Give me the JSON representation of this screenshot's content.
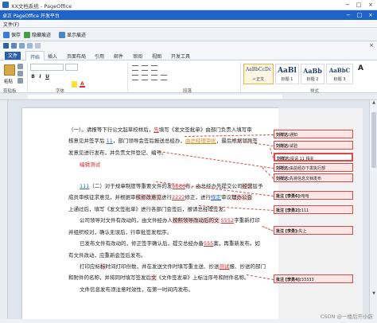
{
  "window": {
    "title": "XX文档系统 - PageOffice",
    "minimize": "−",
    "maximize": "□",
    "close": "×"
  },
  "po": {
    "title": "卓正 PageOffice 开发平台",
    "menu": "文件(F)",
    "toolbar": [
      {
        "label": "保存",
        "color": "#3a7bd5"
      },
      {
        "label": "隐藏痕迹",
        "color": "#4a9a4a"
      },
      {
        "label": "显示痕迹",
        "color": "#4a86c8"
      }
    ]
  },
  "word": {
    "tabs": [
      "文件",
      "开始",
      "插入",
      "页面布局",
      "引用",
      "邮件",
      "审阅",
      "视图",
      "开发工具"
    ],
    "active_tab": "开始",
    "groups": {
      "clipboard": "剪贴板",
      "paste": "粘贴",
      "font": "字体",
      "paragraph": "段落",
      "styles": "样式"
    },
    "format_buttons": [
      "B",
      "I",
      "U"
    ],
    "styles": [
      {
        "sample": "AaBbCcDc",
        "name": "↵正文",
        "active": true
      },
      {
        "sample": "AaBl",
        "name": "标题 1"
      },
      {
        "sample": "AaBb",
        "name": "标题 2"
      },
      {
        "sample": "AaBbC",
        "name": "标题 3"
      }
    ]
  },
  "document": {
    "lines": [
      {
        "parts": [
          {
            "t": "（一）。请报等下行公文起草校样后，"
          },
          {
            "t": "先",
            "c": "ins"
          },
          {
            "t": "填写《发文签批单》由部门负责人填写审"
          }
        ]
      },
      {
        "parts": [
          {
            "t": "核意见并签字后 "
          },
          {
            "t": "11",
            "c": "ins-blue"
          },
          {
            "t": "，部门领导会签后报送总经办，"
          },
          {
            "t": "由总经理审批",
            "c": "ins-orange"
          },
          {
            "t": "，最后根据领导签"
          }
        ]
      },
      {
        "parts": [
          {
            "t": "发意见进行发布，并负责文件登记、编号。"
          }
        ]
      },
      {
        "parts": [
          {
            "t": "编辑测试"
          }
        ],
        "red": true
      },
      {
        "parts": [
          {
            "t": "111",
            "c": "ins-blue"
          },
          {
            "t": "（二）对于规章制度等重要文件的发"
          },
          {
            "t": "6666",
            "c": "ins"
          },
          {
            "t": "布，由总经办先提交公司"
          },
          {
            "t": "经营",
            "c": "hl"
          },
          {
            "t": "层予"
          }
        ]
      },
      {
        "parts": [
          {
            "t": "成员审核征求意见，并根据审"
          },
          {
            "t": "核修改意见",
            "c": "hl"
          },
          {
            "t": "进行"
          },
          {
            "t": "2222",
            "c": "ins"
          },
          {
            "t": "修正，进行"
          },
          {
            "t": "规定",
            "c": "ins-blue"
          },
          {
            "t": "审议"
          },
          {
            "t": "理办公会",
            "c": "hl"
          }
        ]
      },
      {
        "parts": [
          {
            "t": "上通过后，填写《发文签批单》进行各部门会签后，报请总经理签发。"
          }
        ]
      },
      {
        "parts": [
          {
            "t": "公司领导对文件有改动的，由文件经办人"
          },
          {
            "t": "按照领导改动后的文",
            "c": "hl"
          },
          {
            "t": " "
          },
          {
            "t": "5552",
            "c": "ins"
          },
          {
            "t": "字重新打印"
          }
        ]
      },
      {
        "parts": [
          {
            "t": "并组织校对，确认无误后，行审批签发程序。"
          }
        ]
      },
      {
        "parts": [
          {
            "t": "已发布文件有改动的，修正签字确认后，提交总经办备"
          },
          {
            "t": "555",
            "c": "ins"
          },
          {
            "t": "案，再重新发布。如"
          }
        ]
      },
      {
        "parts": [
          {
            "t": "有文件改动，应重新会签后发布。"
          }
        ]
      },
      {
        "parts": [
          {
            "t": "打印应标"
          },
          {
            "t": "标",
            "c": "hl"
          },
          {
            "t": "时间打印份数，并在发送文件时填写重主送、抄送"
          },
          {
            "t": "测试",
            "c": "ins"
          },
          {
            "t": "报、抄送的部门"
          }
        ]
      },
      {
        "parts": [
          {
            "t": "和附件的名称，并将同时填写签发后"
          },
          {
            "t": "文",
            "c": "hl"
          },
          {
            "t": "《文件签发单》上标注序号和附件名称。"
          }
        ]
      },
      {
        "parts": [
          {
            "t": "文件信息发布须注意时效性，在第一时间内发布。"
          }
        ]
      }
    ],
    "comments": [
      {
        "author": "刘祥达:",
        "text": "通知",
        "selected": false
      },
      {
        "author": "刘祥达:",
        "text": "试验",
        "selected": false
      },
      {
        "author": "刘祥达:",
        "text": "提请 11 相关",
        "selected": true
      },
      {
        "author": "刘祥达:",
        "text": "由总经办下发执行部",
        "selected": false
      },
      {
        "author": "刘祥达:",
        "text": "先将信息文档发布",
        "selected": false
      },
      {
        "author": "批注 [李勇6]:",
        "text": "哈哈",
        "selected": false
      },
      {
        "author": "批注 [李勇2]:",
        "text": "111",
        "selected": false
      },
      {
        "author": "批注 [李勇]:",
        "text": "先上",
        "selected": false
      },
      {
        "author": "批注 [李勇4]:",
        "text": "33333",
        "selected": false
      }
    ]
  },
  "watermark": "CSDN @一楼后开小店"
}
